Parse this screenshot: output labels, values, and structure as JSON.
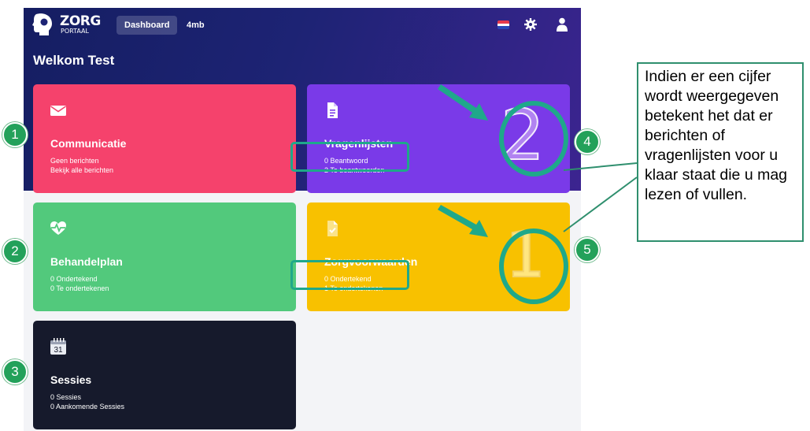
{
  "header": {
    "logo_name": "ZORG",
    "logo_sub": "PORTAAL",
    "tabs": [
      {
        "label": "Dashboard",
        "active": true
      },
      {
        "label": "4mb",
        "active": false
      }
    ],
    "icons": [
      "flag-icon",
      "gear-icon",
      "user-icon"
    ]
  },
  "welcome": "Welkom Test",
  "cards": {
    "communicatie": {
      "title": "Communicatie",
      "line1": "Geen berichten",
      "line2": "Bekijk alle berichten",
      "color": "#f5426c",
      "icon": "envelope-icon"
    },
    "vragenlijsten": {
      "title": "Vragenlijsten",
      "line1": "0 Beantwoord",
      "line2": "2 Te beantwoorden",
      "color": "#7a3ae8",
      "icon": "document-icon",
      "count": "2"
    },
    "behandelplan": {
      "title": "Behandelplan",
      "line1": "0 Ondertekend",
      "line2": "0 Te ondertekenen",
      "color": "#52c97c",
      "icon": "heartbeat-icon"
    },
    "zorgvoorwaarden": {
      "title": "Zorgvoorwaarden",
      "line1": "0 Ondertekend",
      "line2": "1 Te ondertekenen",
      "color": "#f8c100",
      "icon": "document-check-icon",
      "count": "1"
    },
    "sessies": {
      "title": "Sessies",
      "line1": "0 Sessies",
      "line2": "0 Aankomende Sessies",
      "color": "#161a2c",
      "icon": "calendar-icon",
      "calendar_day": "31"
    }
  },
  "annotations": {
    "badges": [
      "1",
      "2",
      "3",
      "4",
      "5"
    ],
    "note": "Indien er een cijfer wordt weergegeven betekent het dat er berichten of vragenlijsten voor u klaar staat die u mag lezen of vullen.",
    "accent": "#1fa88a"
  }
}
